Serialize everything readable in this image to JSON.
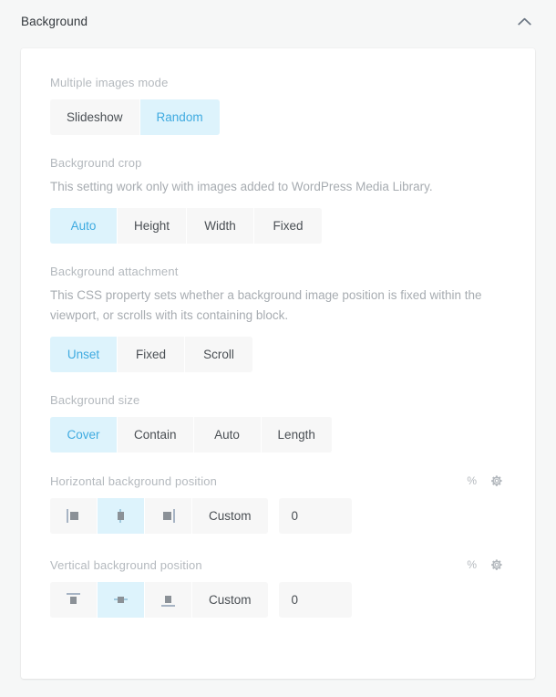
{
  "header": {
    "title": "Background",
    "collapse_icon": "chevron-up-icon"
  },
  "fields": {
    "multiple_images_mode": {
      "label": "Multiple images mode",
      "options": [
        "Slideshow",
        "Random"
      ],
      "selected": "Random"
    },
    "background_crop": {
      "label": "Background crop",
      "description": "This setting work only with images added to WordPress Media Library.",
      "options": [
        "Auto",
        "Height",
        "Width",
        "Fixed"
      ],
      "selected": "Auto"
    },
    "background_attachment": {
      "label": "Background attachment",
      "description": "This CSS property sets whether a background image position is fixed within the viewport, or scrolls with its containing block.",
      "options": [
        "Unset",
        "Fixed",
        "Scroll"
      ],
      "selected": "Unset"
    },
    "background_size": {
      "label": "Background size",
      "options": [
        "Cover",
        "Contain",
        "Auto",
        "Length"
      ],
      "selected": "Cover"
    },
    "horizontal_background_position": {
      "label": "Horizontal background position",
      "unit": "%",
      "settings_icon": "gear-icon",
      "icon_options": [
        "align-left-icon",
        "align-center-icon",
        "align-right-icon"
      ],
      "selected_icon": "align-center-icon",
      "custom_label": "Custom",
      "value": "0",
      "placeholder": "0"
    },
    "vertical_background_position": {
      "label": "Vertical background position",
      "unit": "%",
      "settings_icon": "gear-icon",
      "icon_options": [
        "align-top-icon",
        "align-middle-icon",
        "align-bottom-icon"
      ],
      "selected_icon": "align-middle-icon",
      "custom_label": "Custom",
      "value": "0",
      "placeholder": "0"
    }
  },
  "colors": {
    "accent": "#3eaae0",
    "accent_bg": "#ddf3fc",
    "page_bg": "#f6f7f7",
    "card_bg": "#ffffff",
    "segment_bg": "#f7f7f7",
    "label_gray": "#b4b9be",
    "text_dark": "#4a4f54"
  }
}
